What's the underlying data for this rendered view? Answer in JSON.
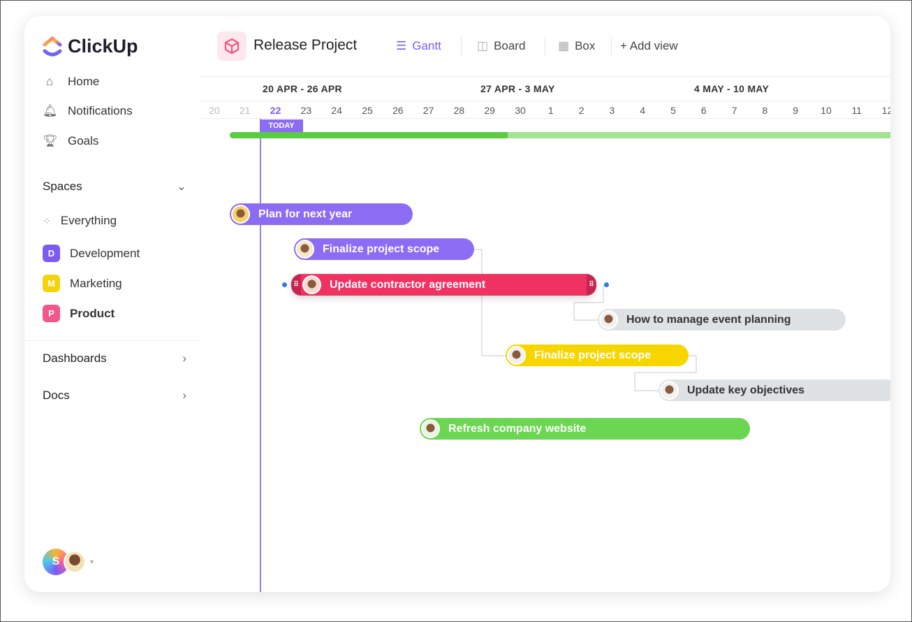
{
  "app": {
    "name": "ClickUp"
  },
  "sidebar": {
    "nav": [
      {
        "label": "Home",
        "icon": "home-icon"
      },
      {
        "label": "Notifications",
        "icon": "bell-icon"
      },
      {
        "label": "Goals",
        "icon": "trophy-icon"
      }
    ],
    "spaces_label": "Spaces",
    "everything": "Everything",
    "spaces": [
      {
        "letter": "D",
        "label": "Development",
        "color": "#7b5cf0"
      },
      {
        "letter": "M",
        "label": "Marketing",
        "color": "#f5d30b"
      },
      {
        "letter": "P",
        "label": "Product",
        "color": "#f2578a"
      }
    ],
    "dashboards": "Dashboards",
    "docs": "Docs",
    "user_initial": "S"
  },
  "header": {
    "title": "Release Project",
    "tabs": [
      {
        "label": "Gantt",
        "active": true
      },
      {
        "label": "Board"
      },
      {
        "label": "Box"
      },
      {
        "label": "+ Add view"
      }
    ]
  },
  "timeline": {
    "weeks": [
      "20 APR - 26 APR",
      "27 APR - 3 MAY",
      "4 MAY - 10 MAY"
    ],
    "days": [
      "20",
      "21",
      "22",
      "23",
      "24",
      "25",
      "26",
      "27",
      "28",
      "29",
      "30",
      "1",
      "2",
      "3",
      "4",
      "5",
      "6",
      "7",
      "8",
      "9",
      "10",
      "11",
      "12"
    ],
    "today_label": "TODAY",
    "today_day": "22",
    "tasks": [
      {
        "label": "Plan for next year",
        "color": "#8b6cf3"
      },
      {
        "label": "Finalize project scope",
        "color": "#8b6cf3"
      },
      {
        "label": "Update contractor agreement",
        "color": "#f03263"
      },
      {
        "label": "How to manage event planning",
        "color": "#dfe2e4"
      },
      {
        "label": "Finalize project scope",
        "color": "#f7d600"
      },
      {
        "label": "Update key objectives",
        "color": "#dfe2e4"
      },
      {
        "label": "Refresh company website",
        "color": "#6bd651"
      }
    ]
  }
}
